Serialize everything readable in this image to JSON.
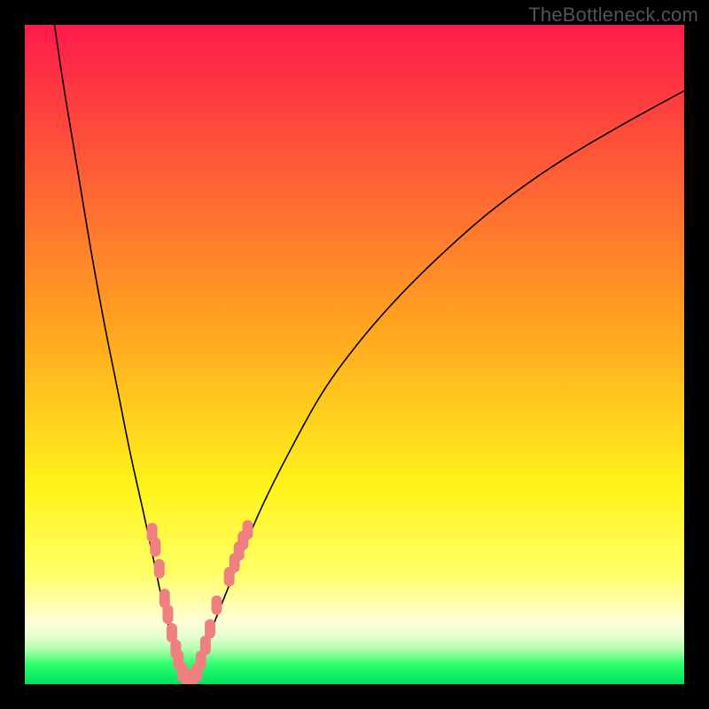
{
  "attribution": "TheBottleneck.com",
  "chart_data": {
    "type": "line",
    "title": "",
    "xlabel": "",
    "ylabel": "",
    "x_range": [
      0,
      100
    ],
    "y_range": [
      0,
      100
    ],
    "background_gradient": {
      "stops": [
        {
          "offset": 0,
          "color": "#ff1a4b"
        },
        {
          "offset": 0.46,
          "color": "#ffa51f"
        },
        {
          "offset": 0.7,
          "color": "#fff31a"
        },
        {
          "offset": 0.83,
          "color": "#ffff66"
        },
        {
          "offset": 0.88,
          "color": "#ffffb0"
        },
        {
          "offset": 0.905,
          "color": "#ffffd8"
        },
        {
          "offset": 0.925,
          "color": "#e8ffd0"
        },
        {
          "offset": 0.945,
          "color": "#b8ffb0"
        },
        {
          "offset": 0.97,
          "color": "#2eff6e"
        },
        {
          "offset": 1.0,
          "color": "#00e060"
        }
      ]
    },
    "series": [
      {
        "name": "left-branch",
        "x": [
          4.5,
          6,
          8,
          10,
          12,
          14,
          16,
          18,
          19.5,
          21,
          22.5,
          24,
          25
        ],
        "y": [
          100,
          90,
          78,
          66,
          55,
          45,
          35,
          26,
          19,
          12,
          6.5,
          2.5,
          0.5
        ]
      },
      {
        "name": "right-branch",
        "x": [
          25,
          26,
          27.5,
          29,
          31,
          33,
          36,
          40,
          45,
          50,
          56,
          63,
          71,
          80,
          90,
          100
        ],
        "y": [
          0.5,
          2.5,
          6,
          10,
          15,
          20,
          27,
          35,
          44,
          51,
          58,
          65,
          72,
          78.5,
          84.5,
          90
        ]
      }
    ],
    "valley_floor_y": 0.5,
    "valley_x_range": [
      23.5,
      26.5
    ],
    "markers": {
      "name": "data-points",
      "color": "#f08080",
      "points": [
        {
          "x": 19.3,
          "y": 23.0
        },
        {
          "x": 19.8,
          "y": 20.8
        },
        {
          "x": 20.4,
          "y": 17.5
        },
        {
          "x": 21.2,
          "y": 13.0
        },
        {
          "x": 21.7,
          "y": 10.6
        },
        {
          "x": 22.3,
          "y": 7.8
        },
        {
          "x": 22.9,
          "y": 5.3
        },
        {
          "x": 23.3,
          "y": 3.7
        },
        {
          "x": 23.9,
          "y": 1.8
        },
        {
          "x": 24.6,
          "y": 0.9
        },
        {
          "x": 25.4,
          "y": 0.9
        },
        {
          "x": 26.1,
          "y": 1.8
        },
        {
          "x": 26.7,
          "y": 3.6
        },
        {
          "x": 27.4,
          "y": 5.9
        },
        {
          "x": 28.1,
          "y": 8.4
        },
        {
          "x": 29.1,
          "y": 12.0
        },
        {
          "x": 31.0,
          "y": 16.3
        },
        {
          "x": 31.8,
          "y": 18.4
        },
        {
          "x": 32.5,
          "y": 20.2
        },
        {
          "x": 33.1,
          "y": 21.8
        },
        {
          "x": 33.8,
          "y": 23.4
        }
      ]
    }
  }
}
